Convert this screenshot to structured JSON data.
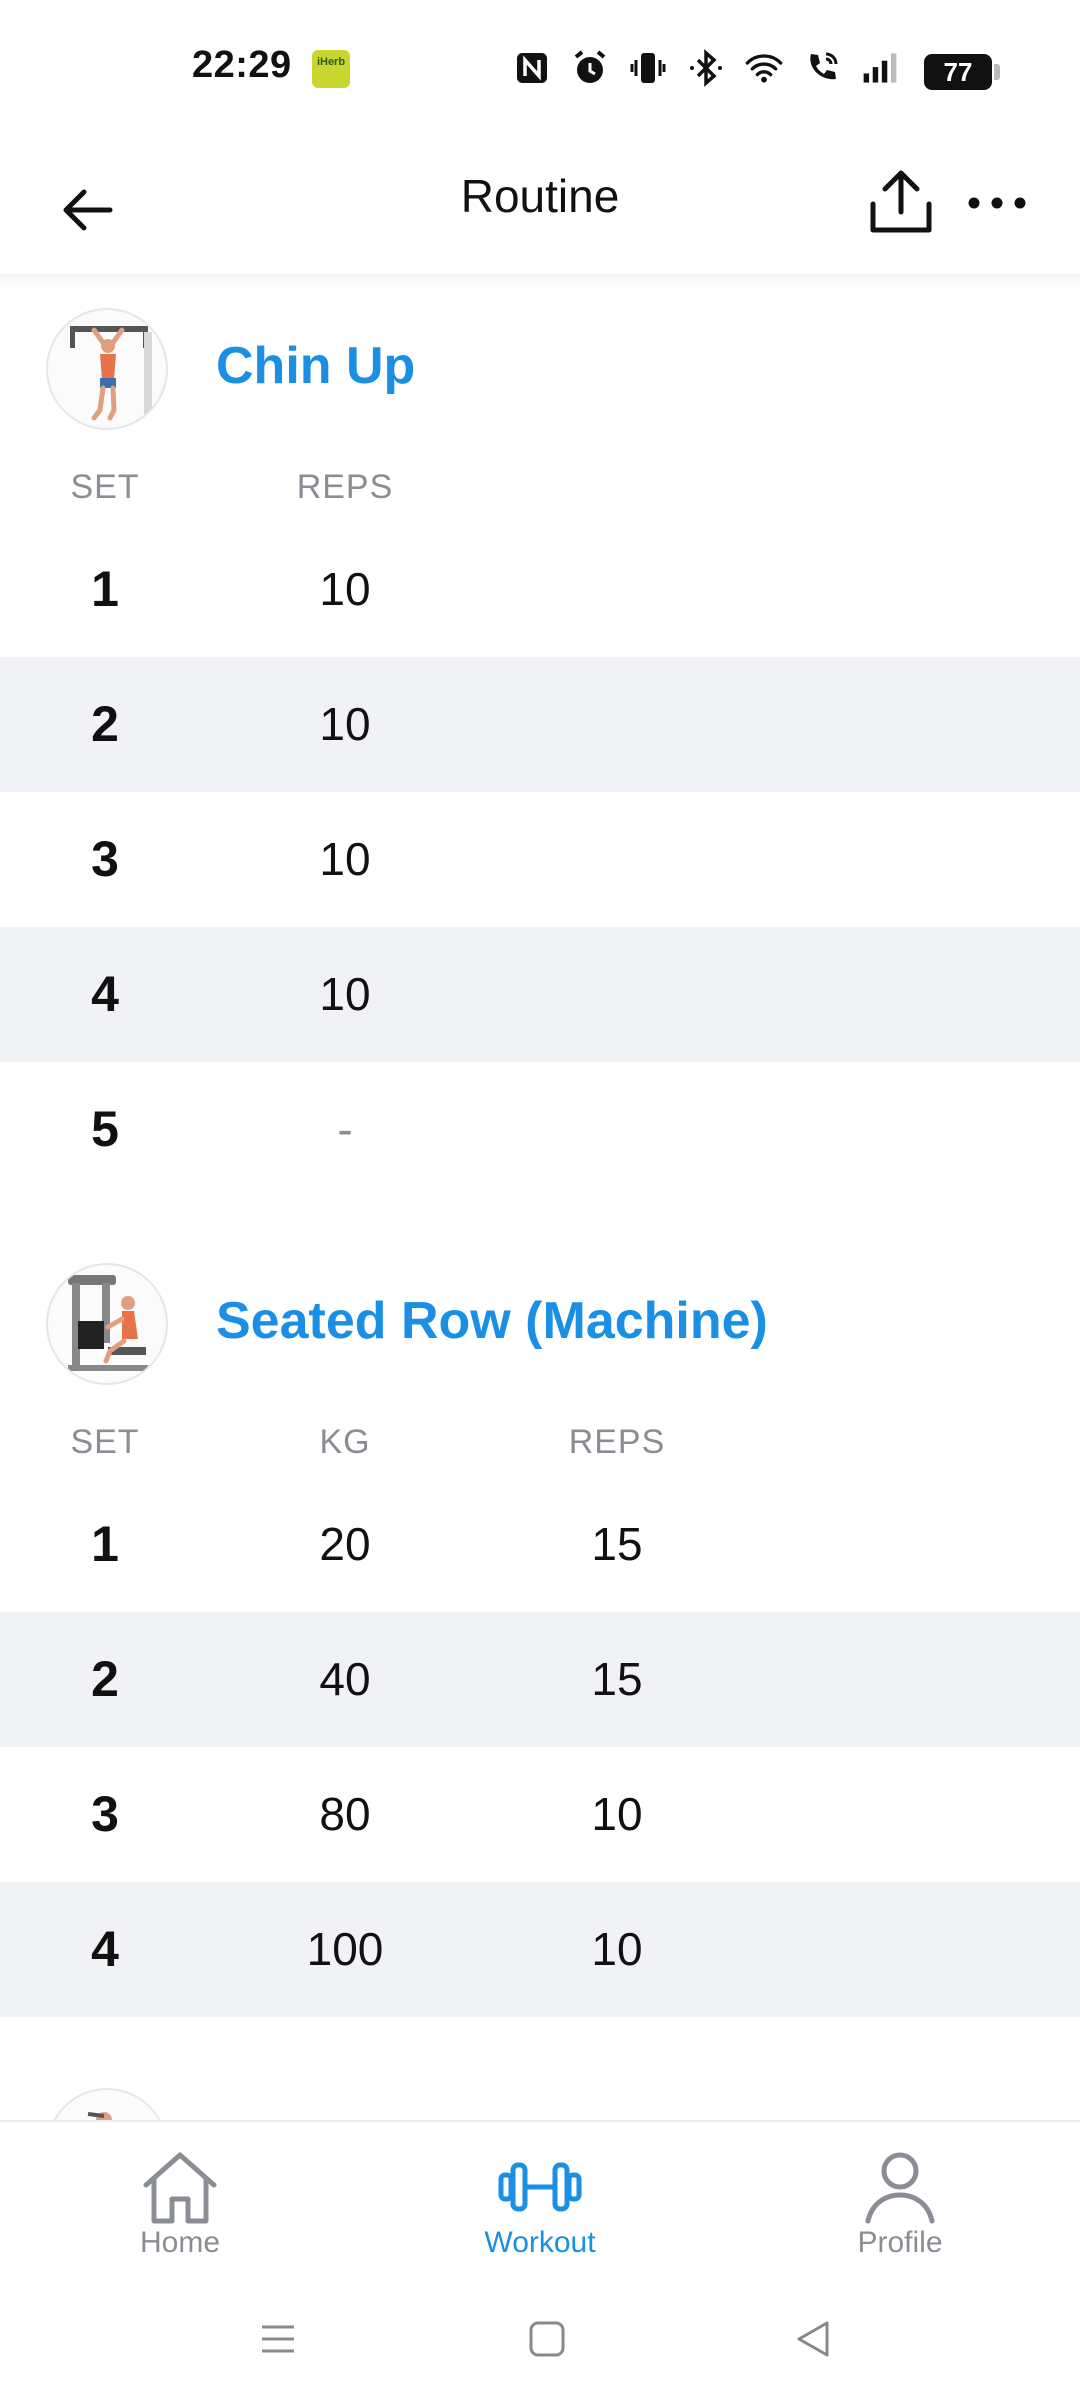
{
  "status_bar": {
    "time": "22:29",
    "app_badge": "iHerb",
    "battery": "77"
  },
  "header": {
    "title": "Routine"
  },
  "exercises": [
    {
      "name": "Chin Up",
      "columns": {
        "set": "SET",
        "reps": "REPS"
      },
      "sets": [
        {
          "set": "1",
          "reps": "10"
        },
        {
          "set": "2",
          "reps": "10"
        },
        {
          "set": "3",
          "reps": "10"
        },
        {
          "set": "4",
          "reps": "10"
        },
        {
          "set": "5",
          "reps": "-"
        }
      ]
    },
    {
      "name": "Seated Row (Machine)",
      "columns": {
        "set": "SET",
        "kg": "KG",
        "reps": "REPS"
      },
      "sets": [
        {
          "set": "1",
          "kg": "20",
          "reps": "15"
        },
        {
          "set": "2",
          "kg": "40",
          "reps": "15"
        },
        {
          "set": "3",
          "kg": "80",
          "reps": "10"
        },
        {
          "set": "4",
          "kg": "100",
          "reps": "10"
        }
      ]
    }
  ],
  "bottom_nav": {
    "items": [
      {
        "label": "Home",
        "icon": "home-icon",
        "active": false
      },
      {
        "label": "Workout",
        "icon": "dumbbell-icon",
        "active": true
      },
      {
        "label": "Profile",
        "icon": "profile-icon",
        "active": false
      }
    ]
  },
  "colors": {
    "accent": "#1a8fe3",
    "row_alt": "#f1f2f6",
    "muted": "#8a8d93"
  }
}
